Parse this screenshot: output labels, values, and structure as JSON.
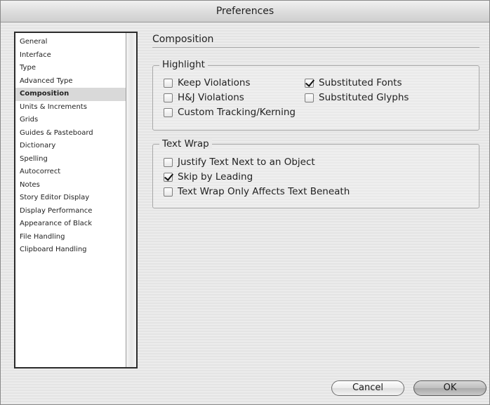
{
  "window": {
    "title": "Preferences"
  },
  "sidebar": {
    "items": [
      "General",
      "Interface",
      "Type",
      "Advanced Type",
      "Composition",
      "Units & Increments",
      "Grids",
      "Guides & Pasteboard",
      "Dictionary",
      "Spelling",
      "Autocorrect",
      "Notes",
      "Story Editor Display",
      "Display Performance",
      "Appearance of Black",
      "File Handling",
      "Clipboard Handling"
    ],
    "selected": "Composition"
  },
  "main": {
    "title": "Composition",
    "highlight": {
      "label": "Highlight",
      "keep_violations": {
        "label": "Keep Violations",
        "checked": false
      },
      "hj_violations": {
        "label": "H&J Violations",
        "checked": false
      },
      "custom_tracking": {
        "label": "Custom Tracking/Kerning",
        "checked": false
      },
      "substituted_fonts": {
        "label": "Substituted Fonts",
        "checked": true
      },
      "substituted_glyphs": {
        "label": "Substituted Glyphs",
        "checked": false
      }
    },
    "text_wrap": {
      "label": "Text Wrap",
      "justify_text": {
        "label": "Justify Text Next to an Object",
        "checked": false
      },
      "skip_by_leading": {
        "label": "Skip by Leading",
        "checked": true
      },
      "affects_beneath": {
        "label": "Text Wrap Only Affects Text Beneath",
        "checked": false
      }
    }
  },
  "buttons": {
    "cancel": "Cancel",
    "ok": "OK"
  }
}
